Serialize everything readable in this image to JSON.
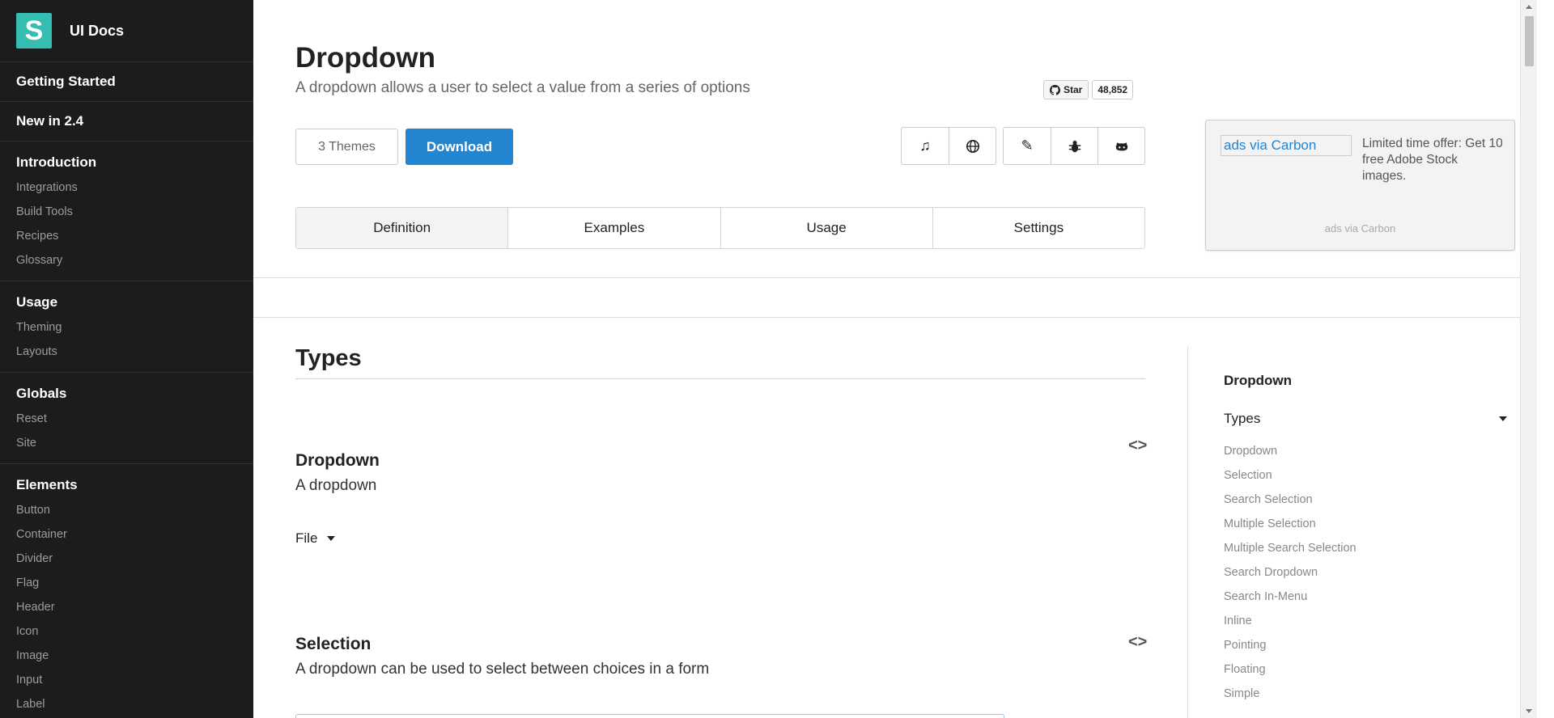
{
  "sidebar": {
    "brand": {
      "logo_letter": "S",
      "name": "UI Docs",
      "accent": "#35bdb2"
    },
    "top_links": [
      "Getting Started",
      "New in 2.4"
    ],
    "sections": [
      {
        "header": "Introduction",
        "items": [
          "Integrations",
          "Build Tools",
          "Recipes",
          "Glossary"
        ]
      },
      {
        "header": "Usage",
        "items": [
          "Theming",
          "Layouts"
        ]
      },
      {
        "header": "Globals",
        "items": [
          "Reset",
          "Site"
        ]
      },
      {
        "header": "Elements",
        "items": [
          "Button",
          "Container",
          "Divider",
          "Flag",
          "Header",
          "Icon",
          "Image",
          "Input",
          "Label"
        ]
      }
    ]
  },
  "page": {
    "title": "Dropdown",
    "subtitle": "A dropdown allows a user to select a value from a series of options",
    "github": {
      "star_label": "Star",
      "count": "48,852"
    },
    "themes_button": "3 Themes",
    "download_button": "Download",
    "icon_groups": [
      [
        "music-icon",
        "globe-icon"
      ],
      [
        "edit-icon",
        "bug-icon",
        "github-icon"
      ]
    ],
    "tabs": [
      "Definition",
      "Examples",
      "Usage",
      "Settings"
    ],
    "active_tab": "Definition",
    "primary_color": "#2185d0"
  },
  "ad": {
    "image_alt": "ads via Carbon",
    "text": "Limited time offer: Get 10 free Adobe Stock images.",
    "footer": "ads via Carbon"
  },
  "content": {
    "section_title": "Types",
    "examples": [
      {
        "title": "Dropdown",
        "description": "A dropdown"
      },
      {
        "title": "Selection",
        "description": "A dropdown can be used to select between choices in a form"
      }
    ],
    "dropdown_value": "File"
  },
  "toc": {
    "title": "Dropdown",
    "section": "Types",
    "items": [
      "Dropdown",
      "Selection",
      "Search Selection",
      "Multiple Selection",
      "Multiple Search Selection",
      "Search Dropdown",
      "Search In-Menu",
      "Inline",
      "Pointing",
      "Floating",
      "Simple"
    ]
  }
}
